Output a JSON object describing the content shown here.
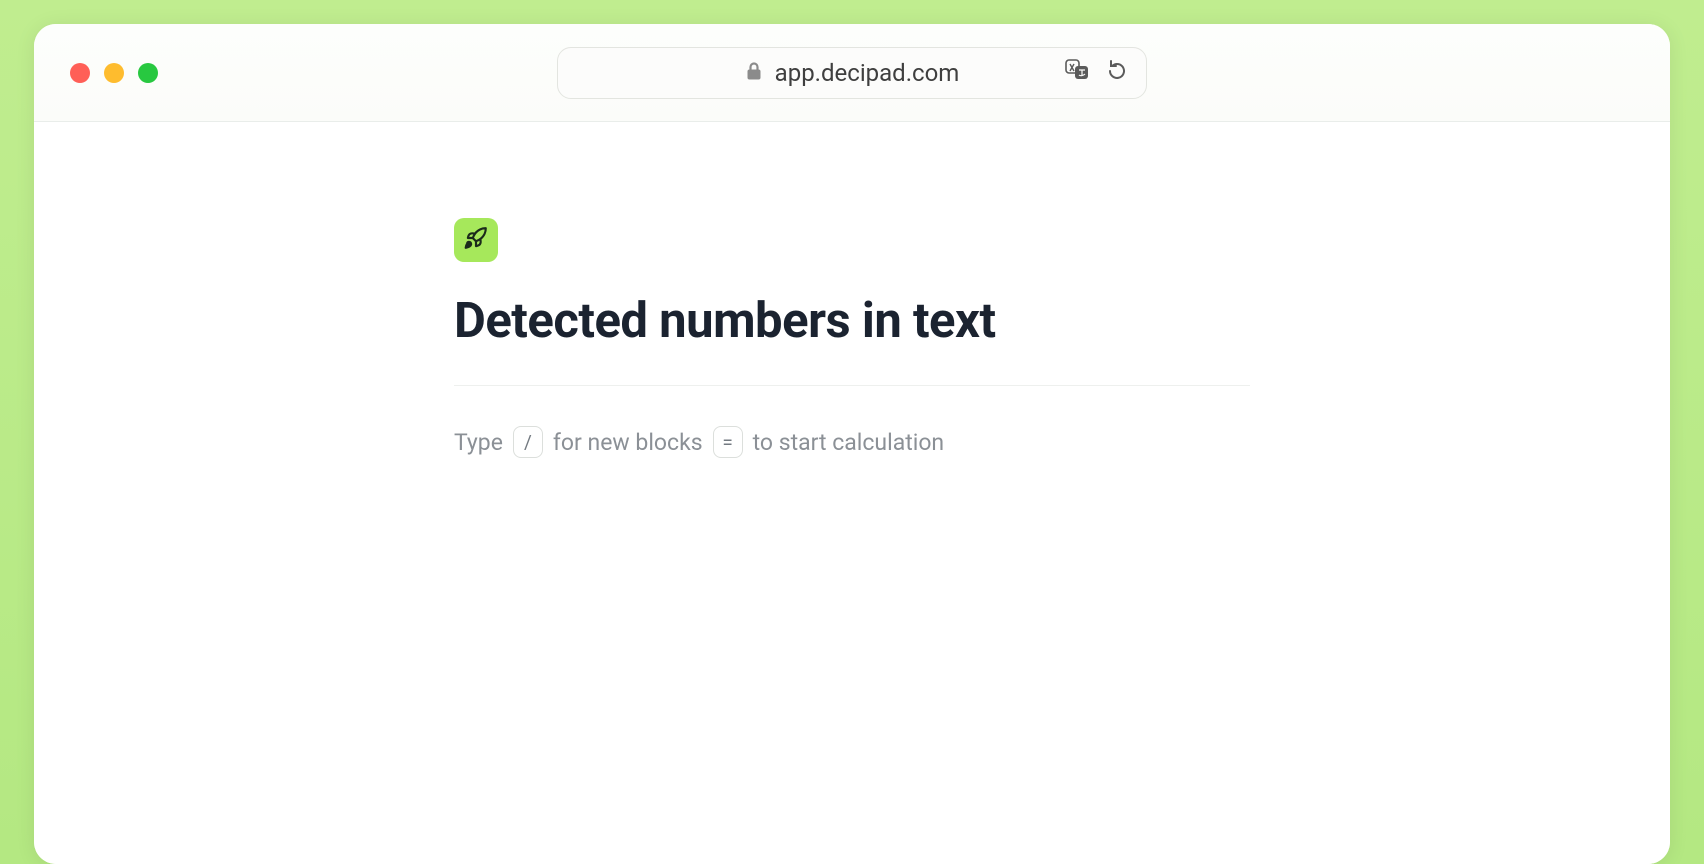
{
  "browser": {
    "url": "app.decipad.com"
  },
  "document": {
    "title": "Detected numbers in text",
    "placeholder": {
      "seg1": "Type",
      "key1": "/",
      "seg2": "for new blocks",
      "key2": "=",
      "seg3": "to start calculation"
    }
  }
}
